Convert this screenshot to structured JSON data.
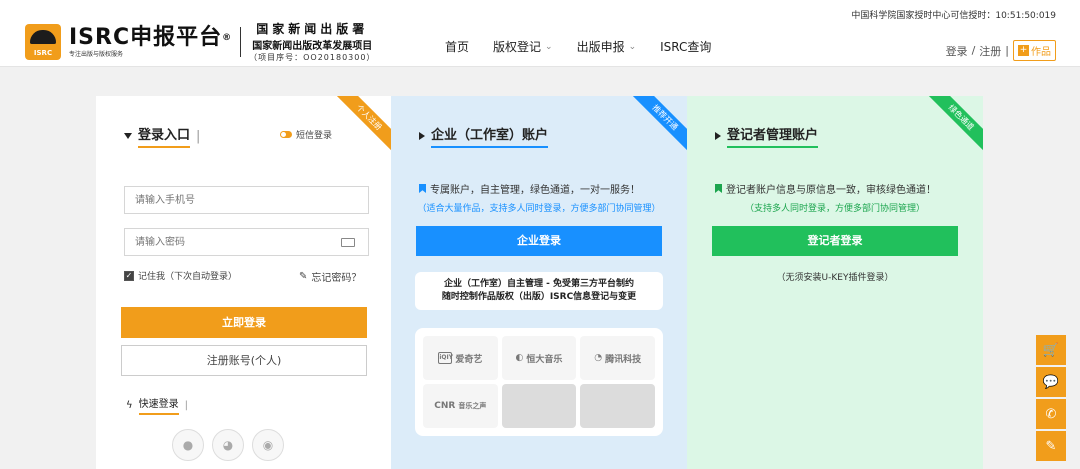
{
  "header": {
    "time_label": "中国科学院国家授时中心可信授时：",
    "time_value": "10:51:50:019",
    "logo_text": "ISRC",
    "brand_name": "ISRC申报平台",
    "brand_reg": "®",
    "brand_sub": "专注出版与版权服务",
    "org_line1": "国家新闻出版署",
    "org_line2": "国家新闻出版改革发展项目",
    "org_line3": "（项目序号：OO20180300）",
    "nav": [
      {
        "label": "首页"
      },
      {
        "label": "版权登记"
      },
      {
        "label": "出版申报"
      },
      {
        "label": "ISRC查询"
      }
    ],
    "login_label": "登录",
    "separator": "/",
    "register_label": "注册",
    "works_label": "作品"
  },
  "login_panel": {
    "ribbon": "个人注册",
    "title": "登录入口",
    "sms_label": "短信登录",
    "phone_placeholder": "请输入手机号",
    "password_placeholder": "请输入密码",
    "remember_label": "记住我（下次自动登录）",
    "forgot_label": "忘记密码？",
    "login_button": "立即登录",
    "register_button": "注册账号(个人)",
    "quick_login_label": "快速登录"
  },
  "enterprise_panel": {
    "ribbon": "推荐开通",
    "title": "企业（工作室）账户",
    "description": "专属账户，自主管理，绿色通道，一对一服务！",
    "description_sub": "（适合大量作品，支持多人同时登录，方便多部门协同管理）",
    "button": "企业登录",
    "notice_line1": "企业（工作室）自主管理 - 免受第三方平台制约",
    "notice_line2": "随时控制作品版权（出版）ISRC信息登记与变更",
    "partners": [
      {
        "name": "爱奇艺",
        "mark": "iQIY"
      },
      {
        "name": "恒大音乐",
        "mark": ""
      },
      {
        "name": "腾讯科技",
        "mark": ""
      },
      {
        "name": "音乐之声",
        "mark": "CNR"
      }
    ]
  },
  "registrant_panel": {
    "ribbon": "绿色通道",
    "title": "登记者管理账户",
    "description": "登记者账户信息与原信息一致，审核绿色通道！",
    "description_sub": "（支持多人同时登录，方便多部门协同管理）",
    "button": "登记者登录",
    "ukey_note": "（无须安装U-KEY插件登录）"
  },
  "colors": {
    "accent_orange": "#f19d1b",
    "enterprise_blue": "#1890ff",
    "registrant_green": "#21c05c"
  },
  "side_buttons": [
    {
      "icon": "cart-icon"
    },
    {
      "icon": "chat-icon"
    },
    {
      "icon": "phone-icon"
    },
    {
      "icon": "edit-icon"
    }
  ]
}
